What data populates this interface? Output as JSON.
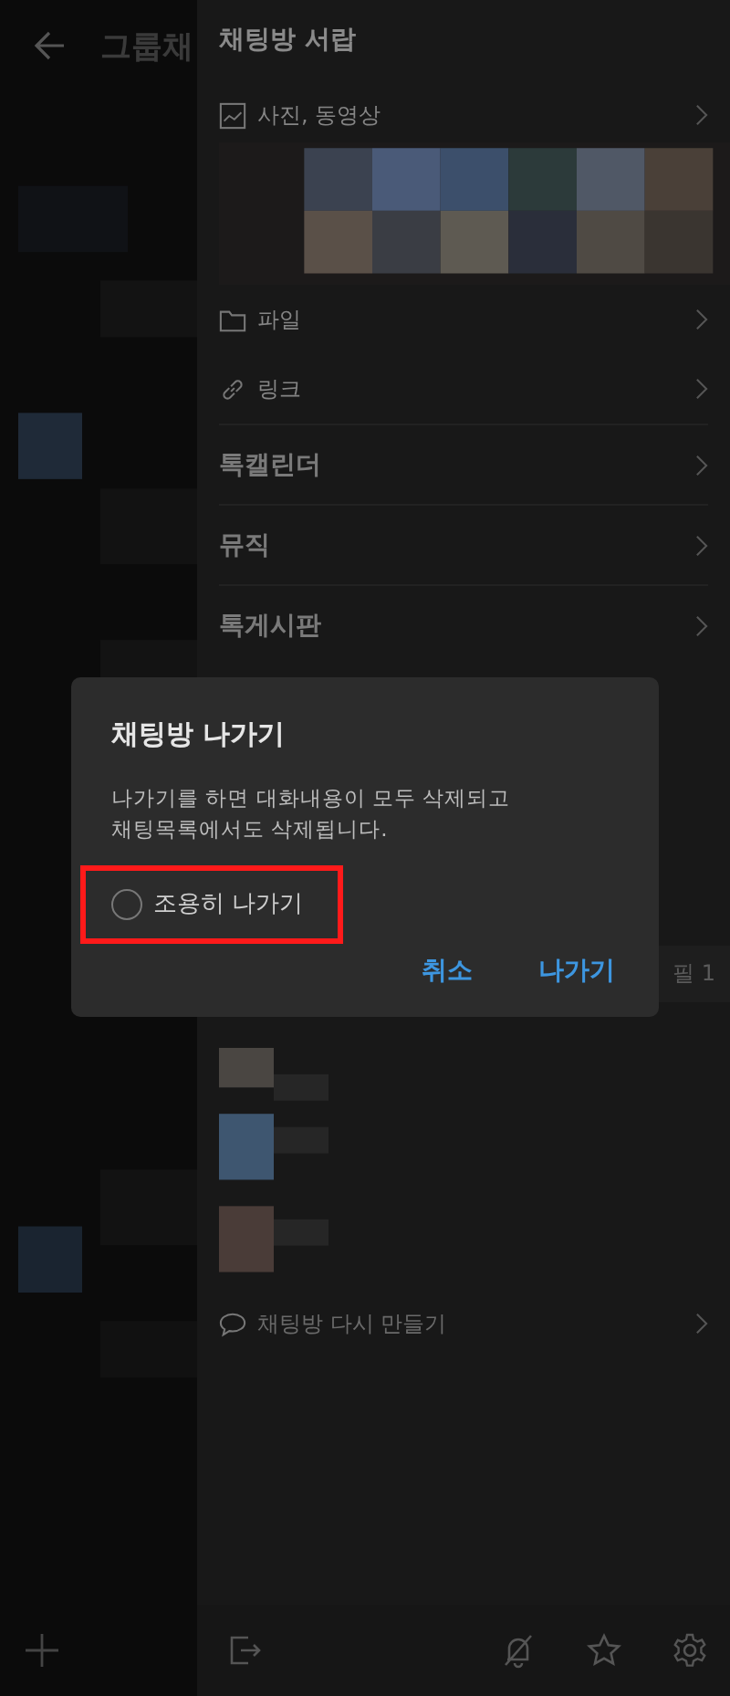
{
  "background_chat": {
    "title": "그룹채"
  },
  "drawer": {
    "title": "채팅방 서랍",
    "rows": [
      {
        "kind": "media",
        "label": "사진, 동영상"
      },
      {
        "kind": "file",
        "label": "파일"
      },
      {
        "kind": "link",
        "label": "링크"
      },
      {
        "kind": "menu",
        "label": "톡캘린더"
      },
      {
        "kind": "menu",
        "label": "뮤직"
      },
      {
        "kind": "menu",
        "label": "톡게시판"
      }
    ],
    "member_count": "필 1",
    "recreate": "채팅방 다시 만들기"
  },
  "dialog": {
    "title": "채팅방 나가기",
    "message": "나가기를 하면 대화내용이 모두 삭제되고\n채팅목록에서도 삭제됩니다.",
    "option": {
      "label": "조용히 나가기",
      "checked": false,
      "highlighted": true
    },
    "buttons": [
      "취소",
      "나가기"
    ]
  }
}
